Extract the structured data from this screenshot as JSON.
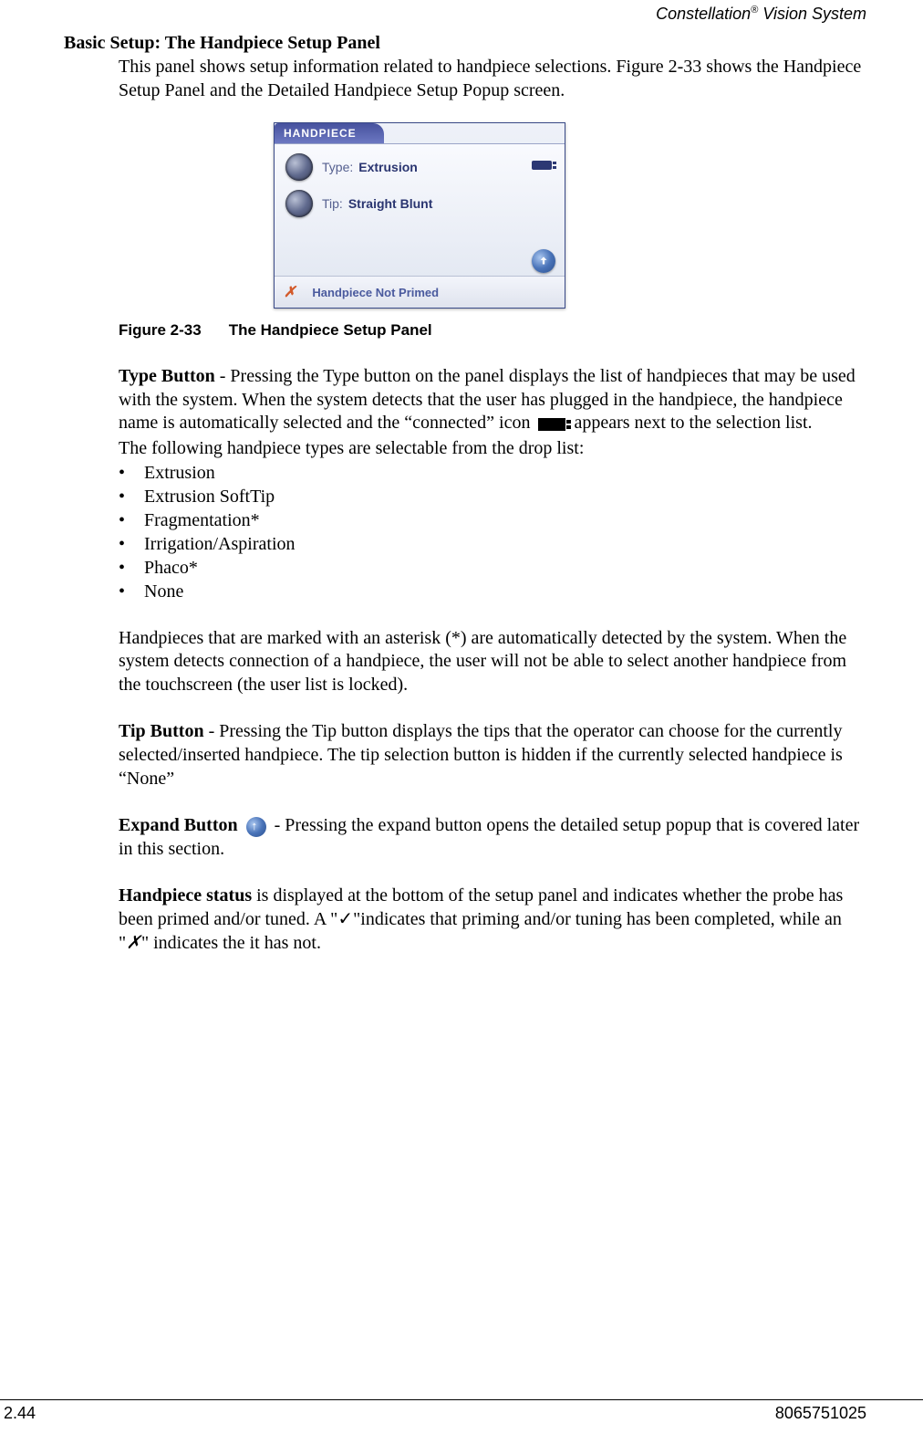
{
  "header": {
    "product": "Constellation",
    "suffix": " Vision System",
    "reg": "®"
  },
  "section_title": "Basic Setup: The Handpiece Setup Panel",
  "intro": "This panel shows setup information related to handpiece selections. Figure 2-33 shows the Handpiece Setup Panel and the Detailed Handpiece Setup Popup screen.",
  "panel": {
    "tab": "HANDPIECE",
    "type_label": "Type:",
    "type_value": "Extrusion",
    "tip_label": "Tip:",
    "tip_value": "Straight Blunt",
    "status": "Handpiece Not Primed"
  },
  "figure": {
    "no": "Figure 2-33",
    "title": "The Handpiece Setup Panel"
  },
  "typebtn": {
    "lead": "Type Button",
    "text_a": " - Pressing the Type button on the panel displays the list of handpieces that may be used with the system. When the system detects that the user has plugged in the handpiece, the handpiece name is automatically selected and the “connected” icon ",
    "text_b": " appears next to the selection list.",
    "list_intro": "The following handpiece types are selectable from the drop list:",
    "items": [
      "Extrusion",
      "Extrusion SoftTip",
      "Fragmentation*",
      "Irrigation/Aspiration",
      "Phaco*",
      "None"
    ]
  },
  "asterisk_note": "Handpieces that are marked with an asterisk (*) are automatically detected by the system. When the system detects connection of a handpiece, the user will not be able to select another handpiece from the touchscreen (the user list is locked).",
  "tipbtn": {
    "lead": "Tip Button",
    "text": " - Pressing the Tip button displays the tips that the operator can choose for the currently selected/inserted handpiece.  The tip selection button is hidden if the currently selected handpiece is “None”"
  },
  "expandbtn": {
    "lead": "Expand Button",
    "text": " - Pressing the expand button opens the detailed setup popup that is covered later in this section."
  },
  "status": {
    "lead": "Handpiece status",
    "a": " is displayed at the bottom of the setup panel and indicates whether the probe has been primed and/or tuned. A \"",
    "check": "✓",
    "b": "\"indicates that priming and/or tuning has been completed, while an \"",
    "cross": "✗",
    "c": "\" indicates the it has not."
  },
  "footer": {
    "page": "2.44",
    "docno": "8065751025"
  }
}
